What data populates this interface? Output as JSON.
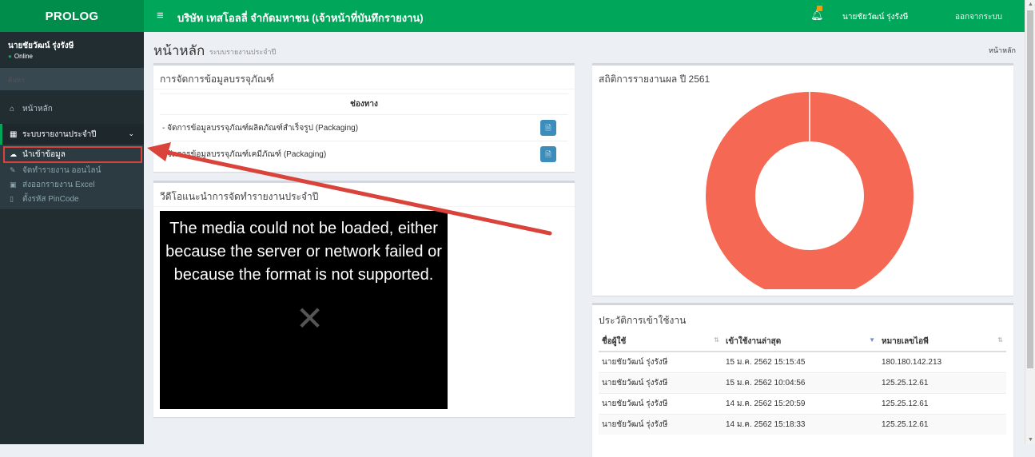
{
  "header": {
    "logo": "PROLOG",
    "company": "บริษัท เทสโอลลี่ จำกัดมหาชน (เจ้าหน้าที่บันทึกรายงาน)",
    "user": "นายชัยวัฒน์ รุ่งรังษี",
    "logout": "ออกจากระบบ"
  },
  "sidebar": {
    "user_name": "นายชัยวัฒน์ รุ่งรังษี",
    "status": "Online",
    "search_placeholder": "ค้นหา",
    "items": [
      {
        "label": "หน้าหลัก",
        "icon": "home-icon"
      },
      {
        "label": "ระบบรายงานประจำปี",
        "icon": "table-icon"
      }
    ],
    "subitems": [
      {
        "label": "นำเข้าข้อมูล",
        "icon": "cloud-upload-icon"
      },
      {
        "label": "จัดทำรายงาน ออนไลน์",
        "icon": "edit-icon"
      },
      {
        "label": "ส่งออกรายงาน Excel",
        "icon": "excel-icon"
      },
      {
        "label": "ตั้งรหัส PinCode",
        "icon": "pin-icon"
      }
    ]
  },
  "page": {
    "title": "หน้าหลัก",
    "subtitle": "ระบบรายงานประจำปี",
    "breadcrumb": "หน้าหลัก"
  },
  "packaging_box": {
    "title": "การจัดการข้อมูลบรรจุภัณฑ์",
    "column_header": "ช่องทาง",
    "rows": [
      {
        "label": "- จัดการข้อมูลบรรจุภัณฑ์ผลิตภัณฑ์สำเร็จรูป (Packaging)"
      },
      {
        "label": "- จัดการข้อมูลบรรจุภัณฑ์เคมีภัณฑ์ (Packaging)"
      }
    ]
  },
  "video_box": {
    "title": "วีดีโอแนะนำการจัดทำรายงานประจำปี",
    "message": "The media could not be loaded, either because the server or network failed or because the format is not supported."
  },
  "stats_box": {
    "title": "สถิติการรายงานผล ปี 2561"
  },
  "chart_data": {
    "type": "pie",
    "donut": true,
    "title": "สถิติการรายงานผล ปี 2561",
    "categories": [
      ""
    ],
    "values": [
      100
    ],
    "colors": [
      "#f56954"
    ]
  },
  "history_box": {
    "title": "ประวัติการเข้าใช้งาน",
    "headers": [
      "ชื่อผู้ใช้",
      "เข้าใช้งานล่าสุด",
      "หมายเลขไอพี"
    ],
    "rows": [
      [
        "นายชัยวัฒน์ รุ่งรังษี",
        "15 ม.ค. 2562 15:15:45",
        "180.180.142.213"
      ],
      [
        "นายชัยวัฒน์ รุ่งรังษี",
        "15 ม.ค. 2562 10:04:56",
        "125.25.12.61"
      ],
      [
        "นายชัยวัฒน์ รุ่งรังษี",
        "14 ม.ค. 2562 15:20:59",
        "125.25.12.61"
      ],
      [
        "นายชัยวัฒน์ รุ่งรังษี",
        "14 ม.ค. 2562 15:18:33",
        "125.25.12.61"
      ]
    ]
  },
  "colors": {
    "topbar": "#00a65a",
    "logo_bg": "#008d4c",
    "sidebar": "#222d32",
    "highlight": "#d9433a",
    "button": "#3c8dbc"
  }
}
